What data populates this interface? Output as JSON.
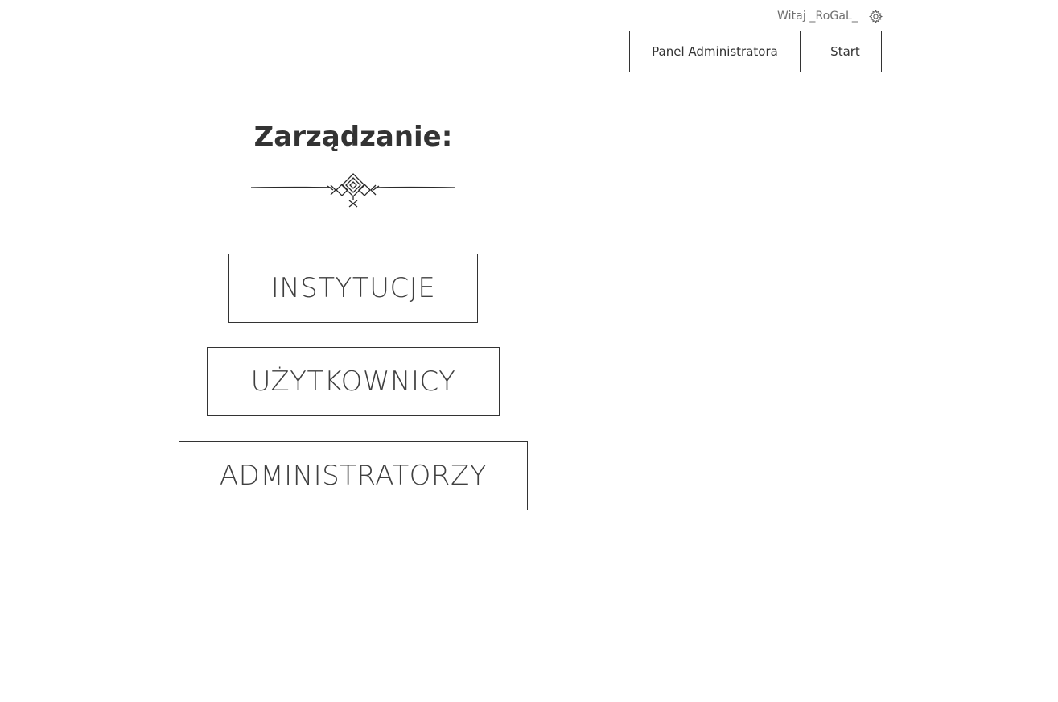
{
  "header": {
    "greeting": "Witaj _RoGaL_",
    "settings_icon": "gear-icon",
    "admin_panel_label": "Panel Administratora",
    "start_label": "Start"
  },
  "main": {
    "heading": "Zarządzanie:",
    "divider_icon": "ornamental-divider",
    "menu": [
      {
        "label": "INSTYTUCJE"
      },
      {
        "label": "UŻYTKOWNICY"
      },
      {
        "label": "ADMINISTRATORZY"
      }
    ]
  },
  "colors": {
    "text": "#333333",
    "muted": "#707070",
    "border": "#333333",
    "background": "#ffffff"
  }
}
